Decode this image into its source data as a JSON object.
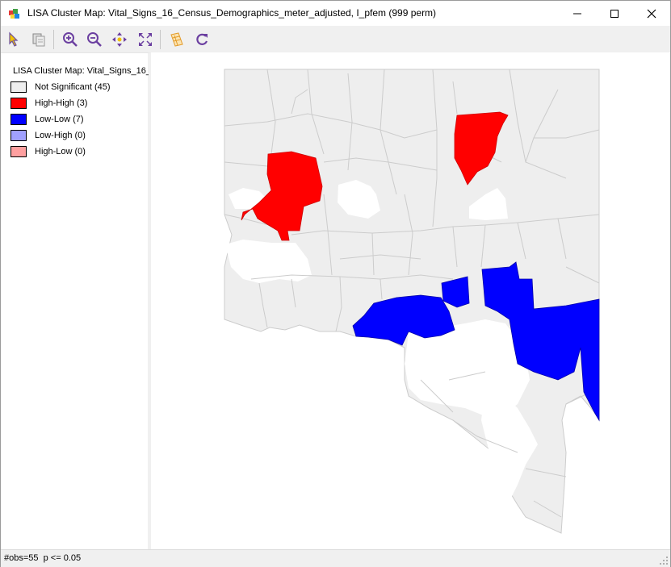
{
  "window": {
    "title": "LISA Cluster Map: Vital_Signs_16_Census_Demographics_meter_adjusted, I_pfem (999 perm)"
  },
  "toolbar": {
    "buttons": [
      {
        "name": "select-tool-button",
        "icon": "pointer-icon"
      },
      {
        "name": "copy-button",
        "icon": "copy-icon"
      },
      {
        "name": "zoom-in-button",
        "icon": "zoom-in-icon"
      },
      {
        "name": "zoom-out-button",
        "icon": "zoom-out-icon"
      },
      {
        "name": "pan-button",
        "icon": "pan-icon"
      },
      {
        "name": "fit-extent-button",
        "icon": "fit-icon"
      },
      {
        "name": "layers-button",
        "icon": "layers-icon"
      },
      {
        "name": "refresh-button",
        "icon": "refresh-icon"
      }
    ]
  },
  "legend": {
    "title": "LISA Cluster Map: Vital_Signs_16_",
    "items": [
      {
        "label": "Not Significant (45)",
        "color": "#eeeeee"
      },
      {
        "label": "High-High (3)",
        "color": "#ff0000"
      },
      {
        "label": "Low-Low (7)",
        "color": "#0000ff"
      },
      {
        "label": "Low-High (0)",
        "color": "#a0a0ff"
      },
      {
        "label": "High-Low (0)",
        "color": "#ffa0a0"
      }
    ]
  },
  "map": {
    "fill_not_significant": "#eeeeee",
    "fill_high_high": "#ff0000",
    "fill_low_low": "#0000ff",
    "stroke": "#cccccc"
  },
  "status": {
    "text": "#obs=55  p <= 0.05"
  }
}
